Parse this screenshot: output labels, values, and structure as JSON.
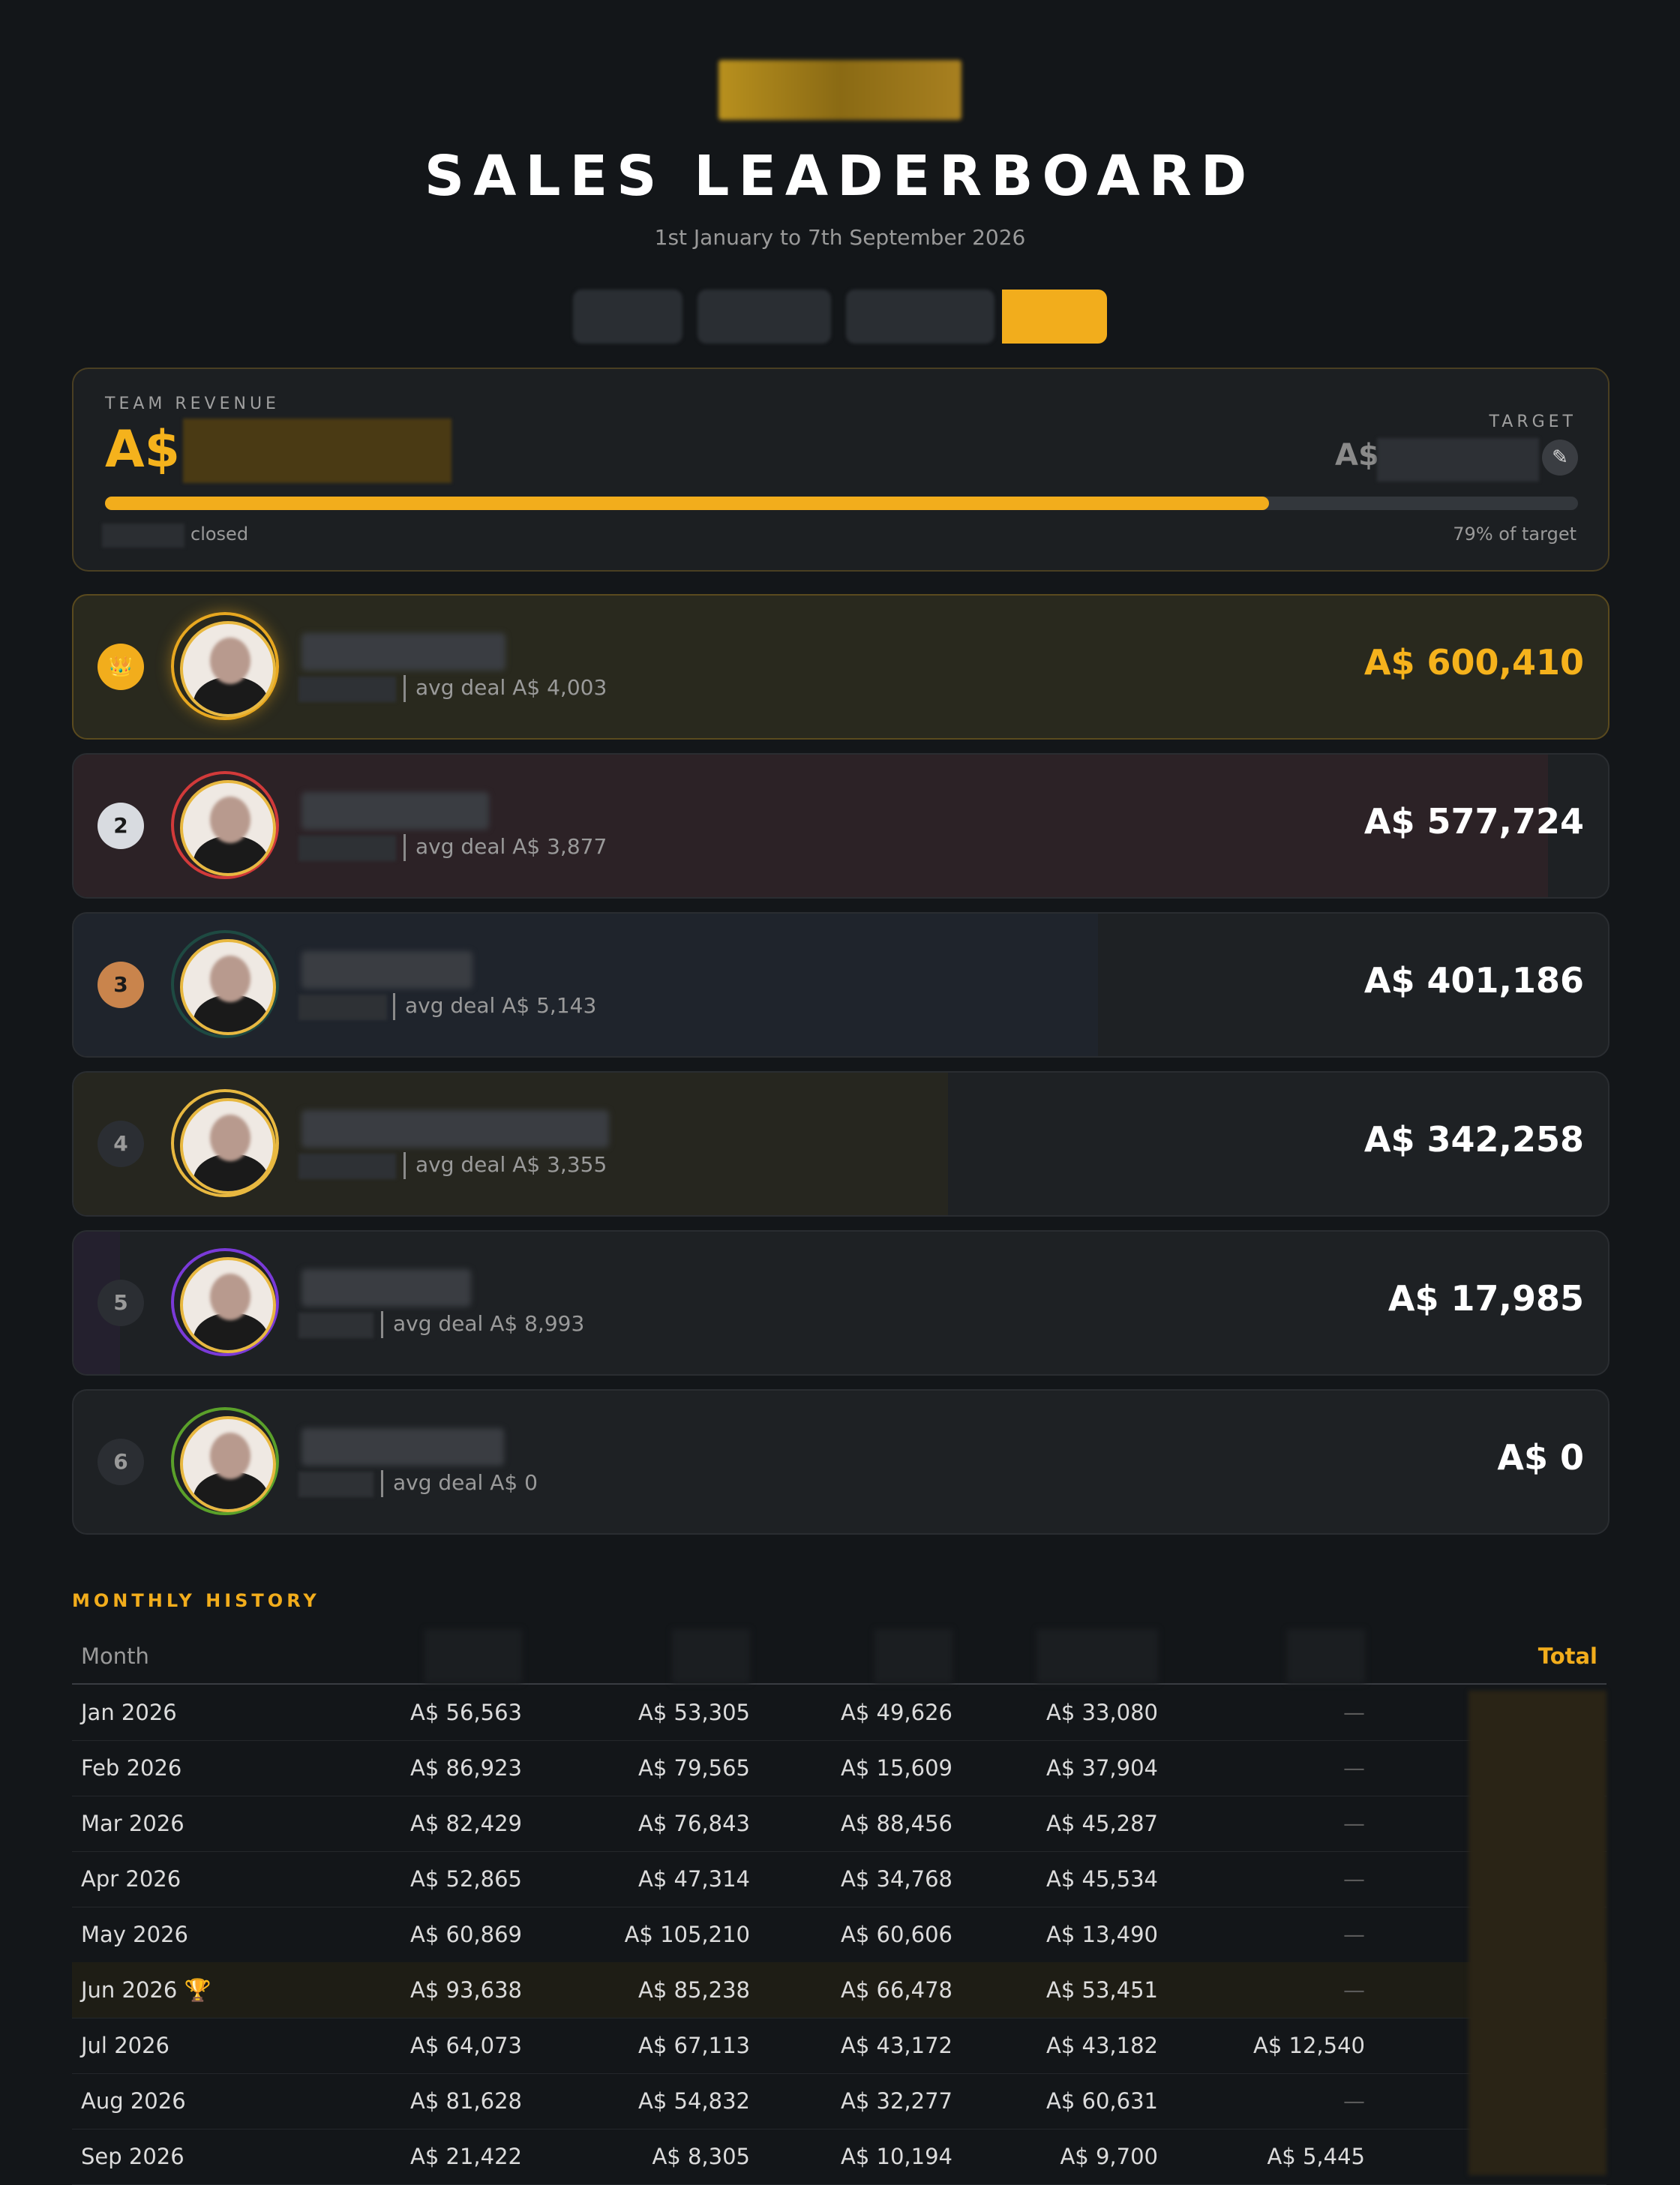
{
  "header": {
    "title": "SALES LEADERBOARD",
    "subtitle": "1st January to 7th September 2026"
  },
  "summary": {
    "label": "TEAM REVENUE",
    "currency": "A$",
    "target_label": "TARGET",
    "target_currency": "A$",
    "closed_text": "closed",
    "progress_percent": 79,
    "progress_text": "79% of target"
  },
  "reps": [
    {
      "rank": "👑",
      "avg": "avg deal A$ 4,003",
      "total": "A$ 600,410"
    },
    {
      "rank": "2",
      "avg": "avg deal A$ 3,877",
      "total": "A$ 577,724"
    },
    {
      "rank": "3",
      "avg": "avg deal A$ 5,143",
      "total": "A$ 401,186"
    },
    {
      "rank": "4",
      "avg": "avg deal A$ 3,355",
      "total": "A$ 342,258"
    },
    {
      "rank": "5",
      "avg": "avg deal A$ 8,993",
      "total": "A$ 17,985"
    },
    {
      "rank": "6",
      "avg": "avg deal A$ 0",
      "total": "A$ 0"
    }
  ],
  "history": {
    "label": "MONTHLY HISTORY",
    "month_header": "Month",
    "total_header": "Total",
    "rows": [
      {
        "month": "Jan 2026",
        "v": [
          "A$ 56,563",
          "A$ 53,305",
          "A$ 49,626",
          "A$ 33,080",
          "—"
        ]
      },
      {
        "month": "Feb 2026",
        "v": [
          "A$ 86,923",
          "A$ 79,565",
          "A$ 15,609",
          "A$ 37,904",
          "—"
        ]
      },
      {
        "month": "Mar 2026",
        "v": [
          "A$ 82,429",
          "A$ 76,843",
          "A$ 88,456",
          "A$ 45,287",
          "—"
        ]
      },
      {
        "month": "Apr 2026",
        "v": [
          "A$ 52,865",
          "A$ 47,314",
          "A$ 34,768",
          "A$ 45,534",
          "—"
        ]
      },
      {
        "month": "May 2026",
        "v": [
          "A$ 60,869",
          "A$ 105,210",
          "A$ 60,606",
          "A$ 13,490",
          "—"
        ]
      },
      {
        "month": "Jun 2026 🏆",
        "v": [
          "A$ 93,638",
          "A$ 85,238",
          "A$ 66,478",
          "A$ 53,451",
          "—"
        ]
      },
      {
        "month": "Jul 2026",
        "v": [
          "A$ 64,073",
          "A$ 67,113",
          "A$ 43,172",
          "A$ 43,182",
          "A$ 12,540"
        ]
      },
      {
        "month": "Aug 2026",
        "v": [
          "A$ 81,628",
          "A$ 54,832",
          "A$ 32,277",
          "A$ 60,631",
          "—"
        ]
      },
      {
        "month": "Sep 2026",
        "v": [
          "A$ 21,422",
          "A$ 8,305",
          "A$ 10,194",
          "A$ 9,700",
          "A$ 5,445"
        ]
      }
    ]
  },
  "colors": {
    "accent": "#f2ad1c",
    "background": "#131619"
  }
}
